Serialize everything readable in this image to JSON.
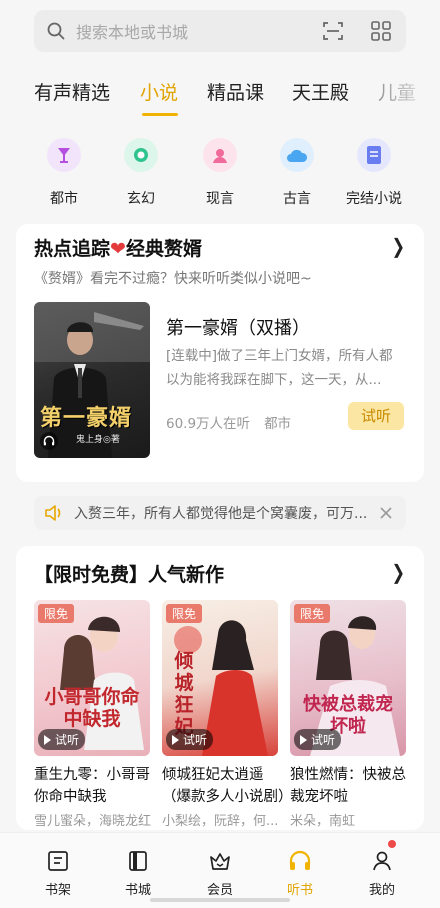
{
  "search": {
    "placeholder": "搜索本地或书城"
  },
  "tabs": [
    {
      "label": "有声精选"
    },
    {
      "label": "小说"
    },
    {
      "label": "精品课"
    },
    {
      "label": "天王殿"
    },
    {
      "label": "儿童"
    }
  ],
  "categories": [
    {
      "label": "都市",
      "color": "#b44fe0"
    },
    {
      "label": "玄幻",
      "color": "#2fc38d"
    },
    {
      "label": "现言",
      "color": "#f06a9a"
    },
    {
      "label": "古言",
      "color": "#4aa6f0"
    },
    {
      "label": "完结小说",
      "color": "#6a7df0"
    }
  ],
  "hot": {
    "title_a": "热点追踪",
    "title_b": "经典赘婿",
    "subtitle": "《赘婿》看完不过瘾？快来听听类似小说吧~",
    "book": {
      "title": "第一豪婿（双播）",
      "desc": "[连载中]做了三年上门女婿，所有人都以为能将我踩在脚下，这一天，从...",
      "listeners": "60.9万人在听",
      "tag": "都市",
      "try_label": "试听",
      "cover_text": "第一豪婿",
      "cover_author": "鬼上身◎著"
    }
  },
  "notice": {
    "text": "入赘三年，所有人都觉得他是个窝囊废，可万..."
  },
  "free": {
    "title": "【限时免费】人气新作",
    "badge": "限免",
    "listen": "试听",
    "books": [
      {
        "title": "重生九零：小哥哥你命中缺我",
        "authors": "雪儿蜜朵，海晓龙红",
        "cover_text": "小哥哥你命中缺我"
      },
      {
        "title": "倾城狂妃太逍遥（爆款多人小说剧）",
        "authors": "小梨绘，阮辞，何...",
        "cover_text": "倾城狂妃"
      },
      {
        "title": "狼性燃情：快被总裁宠坏啦",
        "authors": "米朵，南虹",
        "cover_text": "快被总裁宠坏啦"
      }
    ]
  },
  "nav": [
    {
      "label": "书架"
    },
    {
      "label": "书城"
    },
    {
      "label": "会员"
    },
    {
      "label": "听书"
    },
    {
      "label": "我的"
    }
  ],
  "colors": {
    "accent": "#e2a400",
    "free_badge": "#e9796a",
    "heart": "#e33b3b"
  }
}
